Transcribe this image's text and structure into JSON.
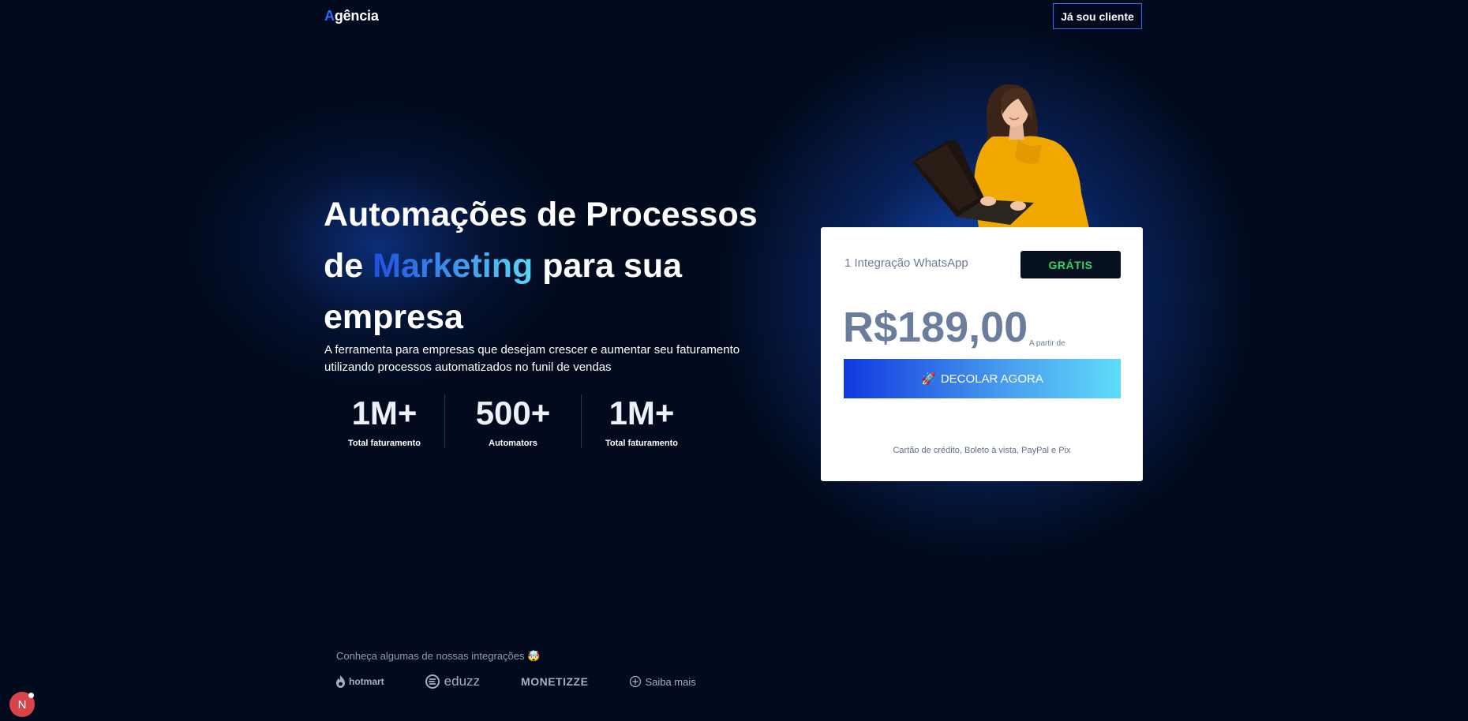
{
  "header": {
    "logo_accent": "A",
    "logo_rest": "gência",
    "client_button": "Já sou cliente"
  },
  "hero": {
    "headline_part1": "Automações de Processos de ",
    "headline_highlight": "Marketing",
    "headline_part2": " para sua empresa",
    "subtitle": "A ferramenta para empresas que desejam crescer e aumentar seu faturamento utilizando processos automatizados no funil de vendas",
    "stats": [
      {
        "value": "1M+",
        "label": "Total faturamento"
      },
      {
        "value": "500+",
        "label": "Automators"
      },
      {
        "value": "1M+",
        "label": "Total faturamento"
      }
    ]
  },
  "pricing": {
    "plan_name": "1 Integração WhatsApp",
    "badge": "GRÁTIS",
    "price": "R$189,00",
    "price_note": "A partir de",
    "cta_icon": "🚀",
    "cta_label": "DECOLAR AGORA",
    "payment_methods": "Cartão de crédito, Boleto à vista, PayPal e Pix"
  },
  "integrations": {
    "title": "Conheça algumas de nossas integrações 🤯",
    "brands": [
      "hotmart",
      "eduzz",
      "MONETIZZE"
    ],
    "more_label": "Saiba mais"
  },
  "floating_badge": {
    "letter": "N"
  },
  "colors": {
    "background": "#020b1e",
    "accent": "#2f6bff",
    "badge_green": "#2bd96b",
    "price_text": "#6b7d9c"
  }
}
